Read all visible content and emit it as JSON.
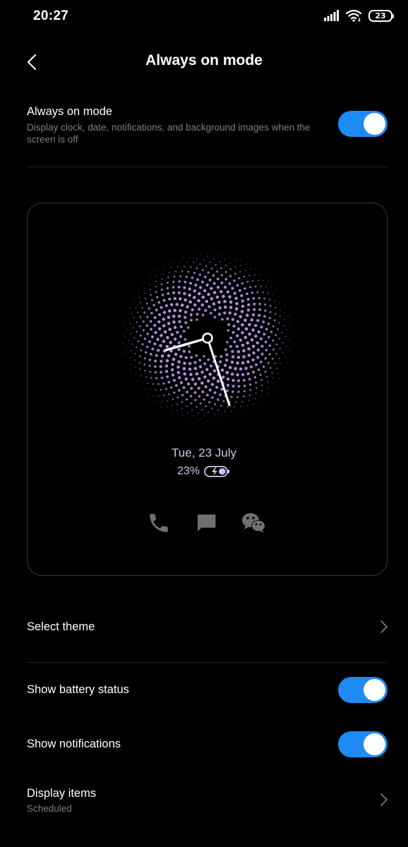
{
  "status_bar": {
    "time": "20:27",
    "battery_level": "23",
    "icons": [
      "signal-icon",
      "wifi-icon",
      "battery-icon"
    ]
  },
  "header": {
    "title": "Always on mode",
    "back_icon": "back-chevron-icon"
  },
  "always_on": {
    "title": "Always on mode",
    "description": "Display clock, date, notifications, and background images when the screen is off",
    "enabled": true
  },
  "preview": {
    "date": "Tue, 23 July",
    "battery_percent": "23%",
    "notification_icons": [
      "phone-icon",
      "message-icon",
      "wechat-icon"
    ]
  },
  "settings": {
    "select_theme": {
      "label": "Select theme"
    },
    "show_battery": {
      "label": "Show battery status",
      "enabled": true
    },
    "show_notifications": {
      "label": "Show notifications",
      "enabled": true
    },
    "display_items": {
      "label": "Display items",
      "sub": "Scheduled"
    }
  },
  "colors": {
    "background": "#000000",
    "accent": "#1d8bf3",
    "secondary_text": "#7e7e7e",
    "preview_text": "#c9c8f0",
    "icon_gray": "#6f6f6f"
  }
}
